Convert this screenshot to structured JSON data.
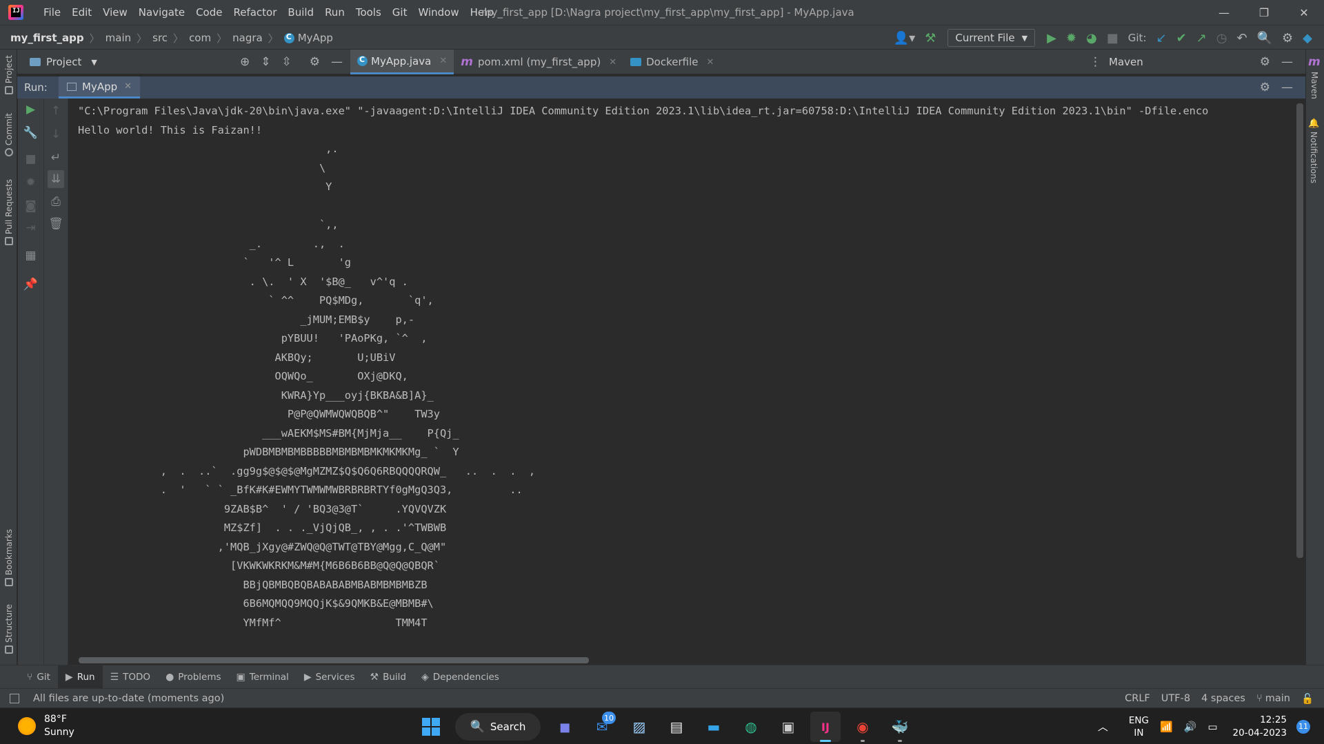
{
  "titlebar": {
    "menu": [
      "File",
      "Edit",
      "View",
      "Navigate",
      "Code",
      "Refactor",
      "Build",
      "Run",
      "Tools",
      "Git",
      "Window",
      "Help"
    ],
    "window_title": "my_first_app [D:\\Nagra project\\my_first_app\\my_first_app] - MyApp.java"
  },
  "navbar": {
    "breadcrumbs": [
      "my_first_app",
      "main",
      "src",
      "com",
      "nagra",
      "MyApp"
    ],
    "run_config": "Current File",
    "git_label": "Git:"
  },
  "left_strip": [
    "Project",
    "Commit",
    "Pull Requests",
    "Bookmarks",
    "Structure"
  ],
  "right_strip": [
    "Maven",
    "Notifications"
  ],
  "project_panel": {
    "label": "Project"
  },
  "editor_tabs": [
    {
      "label": "MyApp.java",
      "active": true
    },
    {
      "label": "pom.xml (my_first_app)",
      "active": false
    },
    {
      "label": "Dockerfile",
      "active": false
    }
  ],
  "maven_panel": {
    "label": "Maven"
  },
  "run_panel": {
    "label": "Run:",
    "tab": "MyApp",
    "console_lines": [
      "\"C:\\Program Files\\Java\\jdk-20\\bin\\java.exe\" \"-javaagent:D:\\IntelliJ IDEA Community Edition 2023.1\\lib\\idea_rt.jar=60758:D:\\IntelliJ IDEA Community Edition 2023.1\\bin\" -Dfile.enco",
      "Hello world! This is Faizan!!",
      "                                       ,.",
      "                                      \\",
      "                                       Y",
      "",
      "                                      `,,",
      "                           _.        .,  .",
      "                          `   '^ L       'g",
      "                           . \\.  ' X  '$B@_   v^'q .",
      "                              ` ^^    PQ$MDg,       `q',",
      "                                   _jMUM;EMB$y    p,-",
      "                                pYBUU!   'PAoPKg, `^  ,",
      "                               AKBQy;       U;UBiV",
      "                               OQWQo_       OXj@DKQ,",
      "                                KWRA}Yp___oyj{BKBA&B]A}_",
      "                                 P@P@QWMWQWQBQB^\"    TW3y",
      "                             ___wAEKM$MS#BM{MjMja__    P{Qj_",
      "                          pWDBMBMBMBBBBBMBMBMBMKMKMKMg_ `  Y",
      "             ,  .  ..`  .gg9g$@$@$@MgMZMZ$Q$Q6Q6RBQQQQRQW_   ..  .  .  ,",
      "             .  '   ` ` _BfK#K#EWMYTWMWMWBRBRBRTYf0gMgQ3Q3,         ..",
      "                       9ZAB$B^  ' / 'BQ3@3@T`     .YQVQVZK",
      "                       MZ$Zf]  . . ._VjQjQB_, , . .'^TWBWB",
      "                      ,'MQB_jXgy@#ZWQ@Q@TWT@TBY@Mgg,C_Q@M\"",
      "                        [VKWKWKRKM&M#M{M6B6B6BB@Q@Q@QBQR`",
      "                          BBjQBMBQBQBABABABMBABMBMBMBZB",
      "                          6B6MQMQQ9MQQjK$&9QMKB&E@MBMB#\\",
      "                          YMfMf^                  TMM4T"
    ]
  },
  "bottom_tabs": [
    {
      "icon": "git-icon",
      "glyph": "⑂",
      "label": "Git",
      "active": false
    },
    {
      "icon": "run-icon",
      "glyph": "▶",
      "label": "Run",
      "active": true
    },
    {
      "icon": "todo-icon",
      "glyph": "☰",
      "label": "TODO",
      "active": false
    },
    {
      "icon": "problems-icon",
      "glyph": "●",
      "label": "Problems",
      "active": false
    },
    {
      "icon": "terminal-icon",
      "glyph": "▣",
      "label": "Terminal",
      "active": false
    },
    {
      "icon": "services-icon",
      "glyph": "▶",
      "label": "Services",
      "active": false
    },
    {
      "icon": "build-icon",
      "glyph": "⚒",
      "label": "Build",
      "active": false
    },
    {
      "icon": "dependencies-icon",
      "glyph": "◈",
      "label": "Dependencies",
      "active": false
    }
  ],
  "statusbar": {
    "message": "All files are up-to-date (moments ago)",
    "line_separator": "CRLF",
    "encoding": "UTF-8",
    "indent": "4 spaces",
    "branch": "main"
  },
  "taskbar": {
    "weather_temp": "88°F",
    "weather_desc": "Sunny",
    "search_label": "Search",
    "mail_badge": "10",
    "lang_top": "ENG",
    "lang_bottom": "IN",
    "time": "12:25",
    "date": "20-04-2023",
    "notification_count": "11"
  },
  "colors": {
    "accent": "#4a88c7",
    "run_green": "#59a869",
    "console_bg": "#2b2b2b",
    "panel_bg": "#3c3f41",
    "run_header_bg": "#3d4a5c"
  }
}
